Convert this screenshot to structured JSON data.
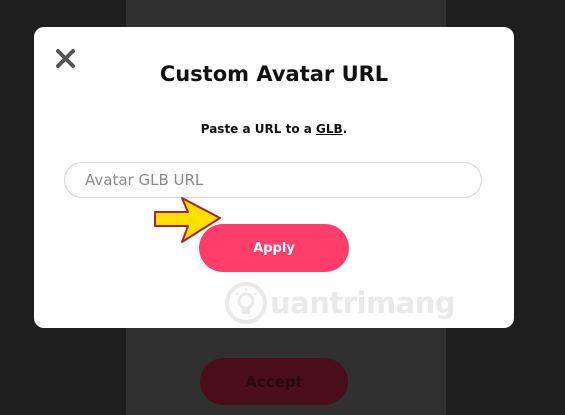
{
  "background": {
    "accept_label": "Accept"
  },
  "modal": {
    "title": "Custom Avatar URL",
    "subtitle_prefix": "Paste a URL to a ",
    "subtitle_link": "GLB",
    "subtitle_suffix": ".",
    "input_placeholder": "Avatar GLB URL",
    "input_value": "",
    "apply_label": "Apply",
    "close_icon": "close-icon"
  },
  "watermark": {
    "text": "uantrimang"
  },
  "colors": {
    "apply_button": "#ff3d6b",
    "overlay": "#2b2b2b",
    "arrow_fill": "#ffe000",
    "arrow_stroke": "#b02030"
  }
}
